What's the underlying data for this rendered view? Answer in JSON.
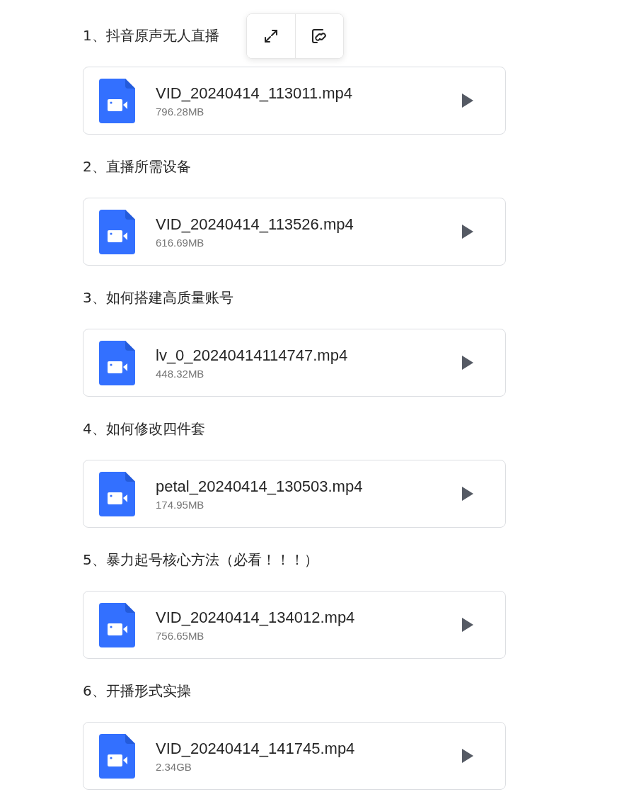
{
  "toolbar": {
    "visible": true
  },
  "sections": [
    {
      "heading": "1、抖音原声无人直播",
      "file": {
        "name": "VID_20240414_113011.mp4",
        "size": "796.28MB"
      }
    },
    {
      "heading": "2、直播所需设备",
      "file": {
        "name": "VID_20240414_113526.mp4",
        "size": "616.69MB"
      }
    },
    {
      "heading": "3、如何搭建高质量账号",
      "file": {
        "name": "lv_0_20240414114747.mp4",
        "size": "448.32MB"
      }
    },
    {
      "heading": "4、如何修改四件套",
      "file": {
        "name": "petal_20240414_130503.mp4",
        "size": "174.95MB"
      }
    },
    {
      "heading": "5、暴力起号核心方法（必看！！！）",
      "file": {
        "name": "VID_20240414_134012.mp4",
        "size": "756.65MB"
      }
    },
    {
      "heading": "6、开播形式实操",
      "file": {
        "name": "VID_20240414_141745.mp4",
        "size": "2.34GB"
      }
    }
  ]
}
